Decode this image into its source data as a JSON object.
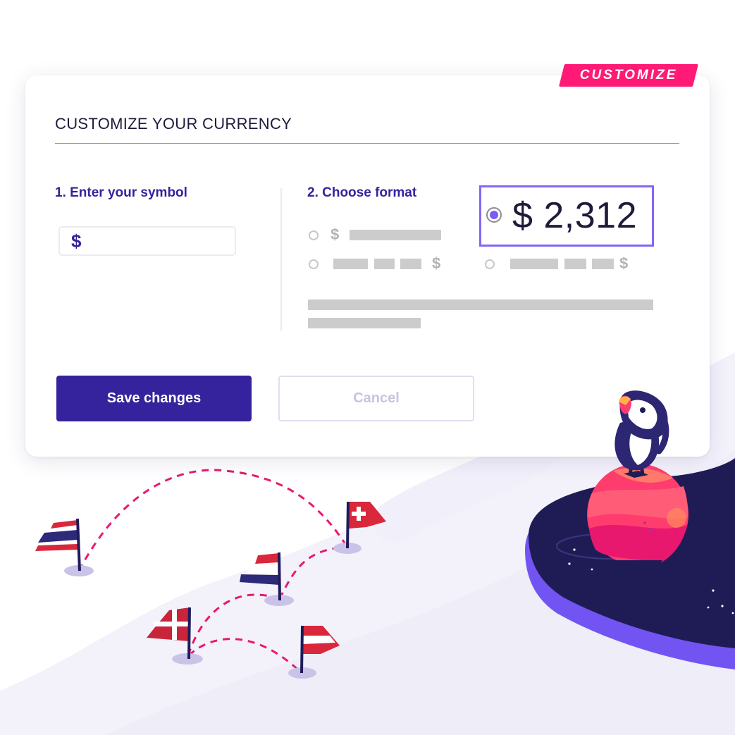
{
  "tag": {
    "label": "CUSTOMIZE"
  },
  "card": {
    "title": "CUSTOMIZE YOUR CURRENCY",
    "step1_label": "1. Enter your symbol",
    "symbol_value": "$",
    "step2_label": "2. Choose format",
    "formats": [
      {
        "symbol": "$",
        "selected": false
      },
      {
        "symbol": "$",
        "selected": false
      },
      {
        "symbol": "$",
        "selected": true,
        "preview": "$ 2,312"
      },
      {
        "symbol": "$",
        "selected": false
      }
    ],
    "save_label": "Save changes",
    "cancel_label": "Cancel"
  },
  "colors": {
    "accent": "#34239c",
    "tag_pink": "#ff1a75",
    "selection_purple": "#8466f5",
    "dashed_path": "#e8186f"
  },
  "icons": [
    "thailand-flag-icon",
    "france-flag-icon",
    "switzerland-flag-icon",
    "denmark-flag-icon",
    "austria-flag-icon",
    "puffin-mascot-icon",
    "planet-icon"
  ]
}
